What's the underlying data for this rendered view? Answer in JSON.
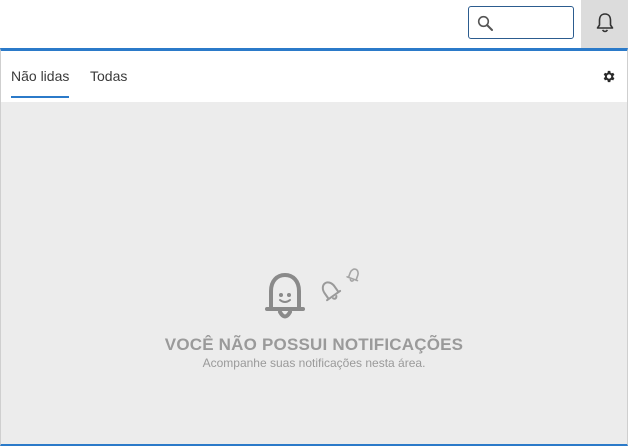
{
  "header": {
    "search": {
      "placeholder": "",
      "value": "",
      "icon": "search-icon"
    },
    "notifications_icon": "bell-icon"
  },
  "panel": {
    "tabs": [
      {
        "label": "Não lidas",
        "active": true
      },
      {
        "label": "Todas",
        "active": false
      }
    ],
    "settings_icon": "gear-icon",
    "empty_state": {
      "icon": "bell-smile-icon",
      "title": "VOCÊ NÃO POSSUI NOTIFICAÇÕES",
      "subtitle": "Acompanhe suas notificações nesta área."
    }
  },
  "colors": {
    "accent": "#2b7ac9",
    "panel_background": "#ececec",
    "muted_text": "#9a9a9a"
  }
}
